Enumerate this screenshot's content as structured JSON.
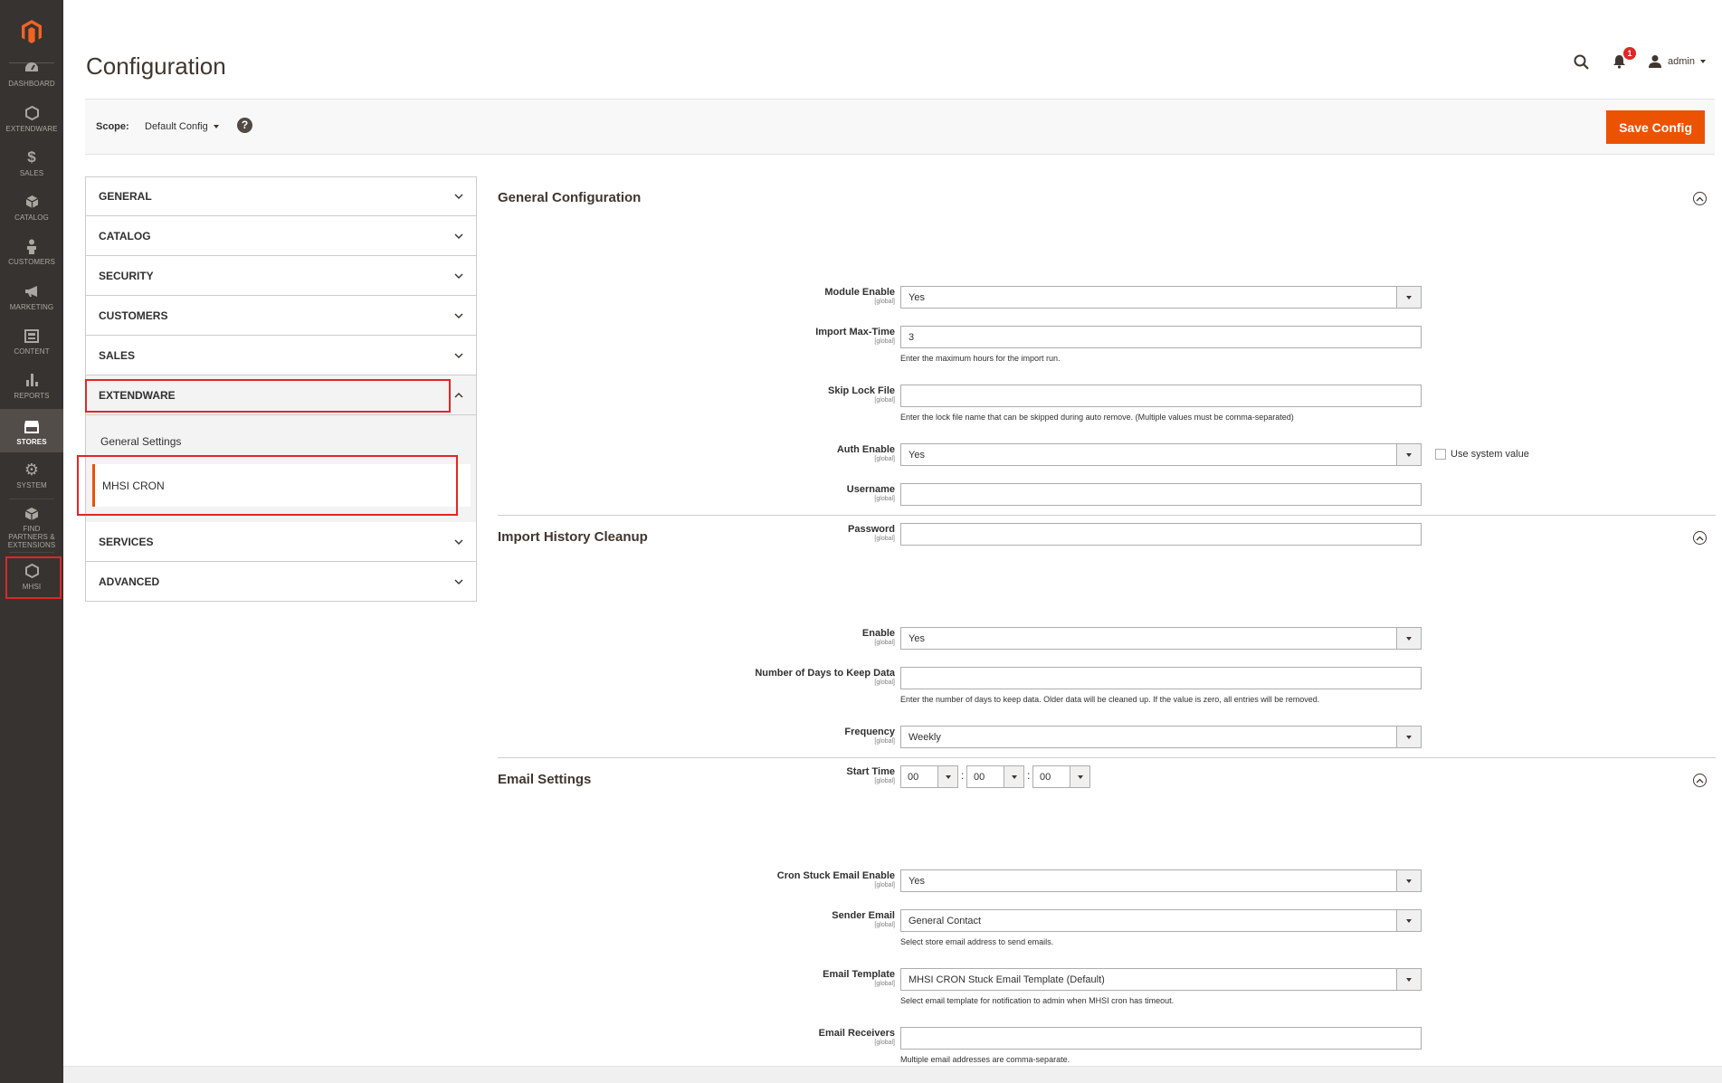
{
  "page": {
    "title": "Configuration"
  },
  "header": {
    "notifications_count": "1",
    "user": "admin"
  },
  "scope": {
    "label": "Scope:",
    "value": "Default Config",
    "help": "?"
  },
  "toolbar": {
    "save_label": "Save Config"
  },
  "nav": {
    "items": [
      {
        "label": "DASHBOARD",
        "icon": "dashboard-icon"
      },
      {
        "label": "EXTENDWARE",
        "icon": "hexagon-icon"
      },
      {
        "label": "SALES",
        "icon": "dollar-icon"
      },
      {
        "label": "CATALOG",
        "icon": "box-icon"
      },
      {
        "label": "CUSTOMERS",
        "icon": "person-icon"
      },
      {
        "label": "MARKETING",
        "icon": "megaphone-icon"
      },
      {
        "label": "CONTENT",
        "icon": "content-icon"
      },
      {
        "label": "REPORTS",
        "icon": "bar-chart-icon"
      },
      {
        "label": "STORES",
        "icon": "store-icon"
      },
      {
        "label": "SYSTEM",
        "icon": "gear-icon"
      },
      {
        "label": "FIND PARTNERS & EXTENSIONS",
        "icon": "cubes-icon"
      },
      {
        "label": "MHSI",
        "icon": "hexagon-icon"
      }
    ]
  },
  "tabs": {
    "items": [
      "GENERAL",
      "CATALOG",
      "SECURITY",
      "CUSTOMERS",
      "SALES",
      "EXTENDWARE",
      "SERVICES",
      "ADVANCED"
    ],
    "extendware_sub": [
      "General Settings",
      "MHSI CRON"
    ]
  },
  "sections": {
    "general": {
      "title": "General Configuration",
      "module_enable": {
        "label": "Module Enable",
        "scope": "[global]",
        "value": "Yes"
      },
      "import_max_time": {
        "label": "Import Max-Time",
        "scope": "[global]",
        "value": "3",
        "note": "Enter the maximum hours for the import run."
      },
      "skip_lock_file": {
        "label": "Skip Lock File",
        "scope": "[global]",
        "value": "",
        "note": "Enter the lock file name that can be skipped during auto remove. (Multiple values must be comma-separated)"
      },
      "auth_enable": {
        "label": "Auth Enable",
        "scope": "[global]",
        "value": "Yes",
        "use_system": "Use system value"
      },
      "username": {
        "label": "Username",
        "scope": "[global]",
        "value": ""
      },
      "password": {
        "label": "Password",
        "scope": "[global]",
        "value": ""
      }
    },
    "cleanup": {
      "title": "Import History Cleanup",
      "enable": {
        "label": "Enable",
        "scope": "[global]",
        "value": "Yes"
      },
      "days": {
        "label": "Number of Days to Keep Data",
        "scope": "[global]",
        "value": "",
        "note": "Enter the number of days to keep data. Older data will be cleaned up. If the value is zero, all entries will be removed."
      },
      "frequency": {
        "label": "Frequency",
        "scope": "[global]",
        "value": "Weekly"
      },
      "start_time": {
        "label": "Start Time",
        "scope": "[global]",
        "hour": "00",
        "minute": "00",
        "second": "00",
        "sep": ":"
      }
    },
    "email": {
      "title": "Email Settings",
      "cron_stuck": {
        "label": "Cron Stuck Email Enable",
        "scope": "[global]",
        "value": "Yes"
      },
      "sender": {
        "label": "Sender Email",
        "scope": "[global]",
        "value": "General Contact",
        "note": "Select store email address to send emails."
      },
      "template": {
        "label": "Email Template",
        "scope": "[global]",
        "value": "MHSI CRON Stuck Email Template (Default)",
        "note": "Select email template for notification to admin when MHSI cron has timeout."
      },
      "receivers": {
        "label": "Email Receivers",
        "scope": "[global]",
        "value": "",
        "note": "Multiple email addresses are comma-separate."
      }
    }
  },
  "colors": {
    "accent": "#eb5202",
    "nav_bg": "#373330",
    "highlight": "#e22626"
  }
}
